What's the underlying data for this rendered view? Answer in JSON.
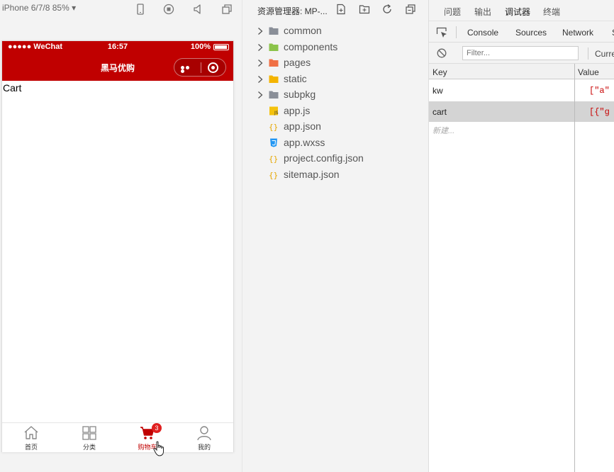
{
  "simulator": {
    "device_label": "iPhone 6/7/8 85% ▾",
    "status_bar": {
      "carrier": "●●●●● WeChat",
      "time": "16:57",
      "battery": "100%"
    },
    "nav_title": "黑马优购",
    "page_text": "Cart",
    "tabs": [
      {
        "label": "首页",
        "icon": "home-icon"
      },
      {
        "label": "分类",
        "icon": "grid-icon"
      },
      {
        "label": "购物车",
        "icon": "cart-icon",
        "badge": "3",
        "active": true
      },
      {
        "label": "我的",
        "icon": "user-icon"
      }
    ],
    "accent_color": "#c00000"
  },
  "explorer": {
    "title": "资源管理器: MP-...",
    "items": [
      {
        "label": "common",
        "type": "folder",
        "icon_color": "#8a8f98"
      },
      {
        "label": "components",
        "type": "folder",
        "icon_color": "#8bc34a"
      },
      {
        "label": "pages",
        "type": "folder",
        "icon_color": "#f07045"
      },
      {
        "label": "static",
        "type": "folder",
        "icon_color": "#f4b400"
      },
      {
        "label": "subpkg",
        "type": "folder",
        "icon_color": "#8a8f98"
      },
      {
        "label": "app.js",
        "type": "js-file",
        "icon_color": "#f4c20d"
      },
      {
        "label": "app.json",
        "type": "json-file",
        "icon_color": "#e6a700"
      },
      {
        "label": "app.wxss",
        "type": "css-file",
        "icon_color": "#2196f3"
      },
      {
        "label": "project.config.json",
        "type": "json-file",
        "icon_color": "#e6a700"
      },
      {
        "label": "sitemap.json",
        "type": "json-file",
        "icon_color": "#e6a700"
      }
    ]
  },
  "debugger": {
    "top_tabs": [
      "问题",
      "输出",
      "调试器",
      "终端"
    ],
    "active_top_tab": "调试器",
    "devtools_tabs": [
      "Console",
      "Sources",
      "Network",
      "S"
    ],
    "filter_placeholder": "Filter...",
    "current_label": "Curre",
    "table": {
      "key_header": "Key",
      "value_header": "Value",
      "rows": [
        {
          "key": "kw",
          "value": "[\"a\""
        },
        {
          "key": "cart",
          "value": "[{\"g",
          "selected": true
        }
      ],
      "new_entry": "新建..."
    }
  }
}
